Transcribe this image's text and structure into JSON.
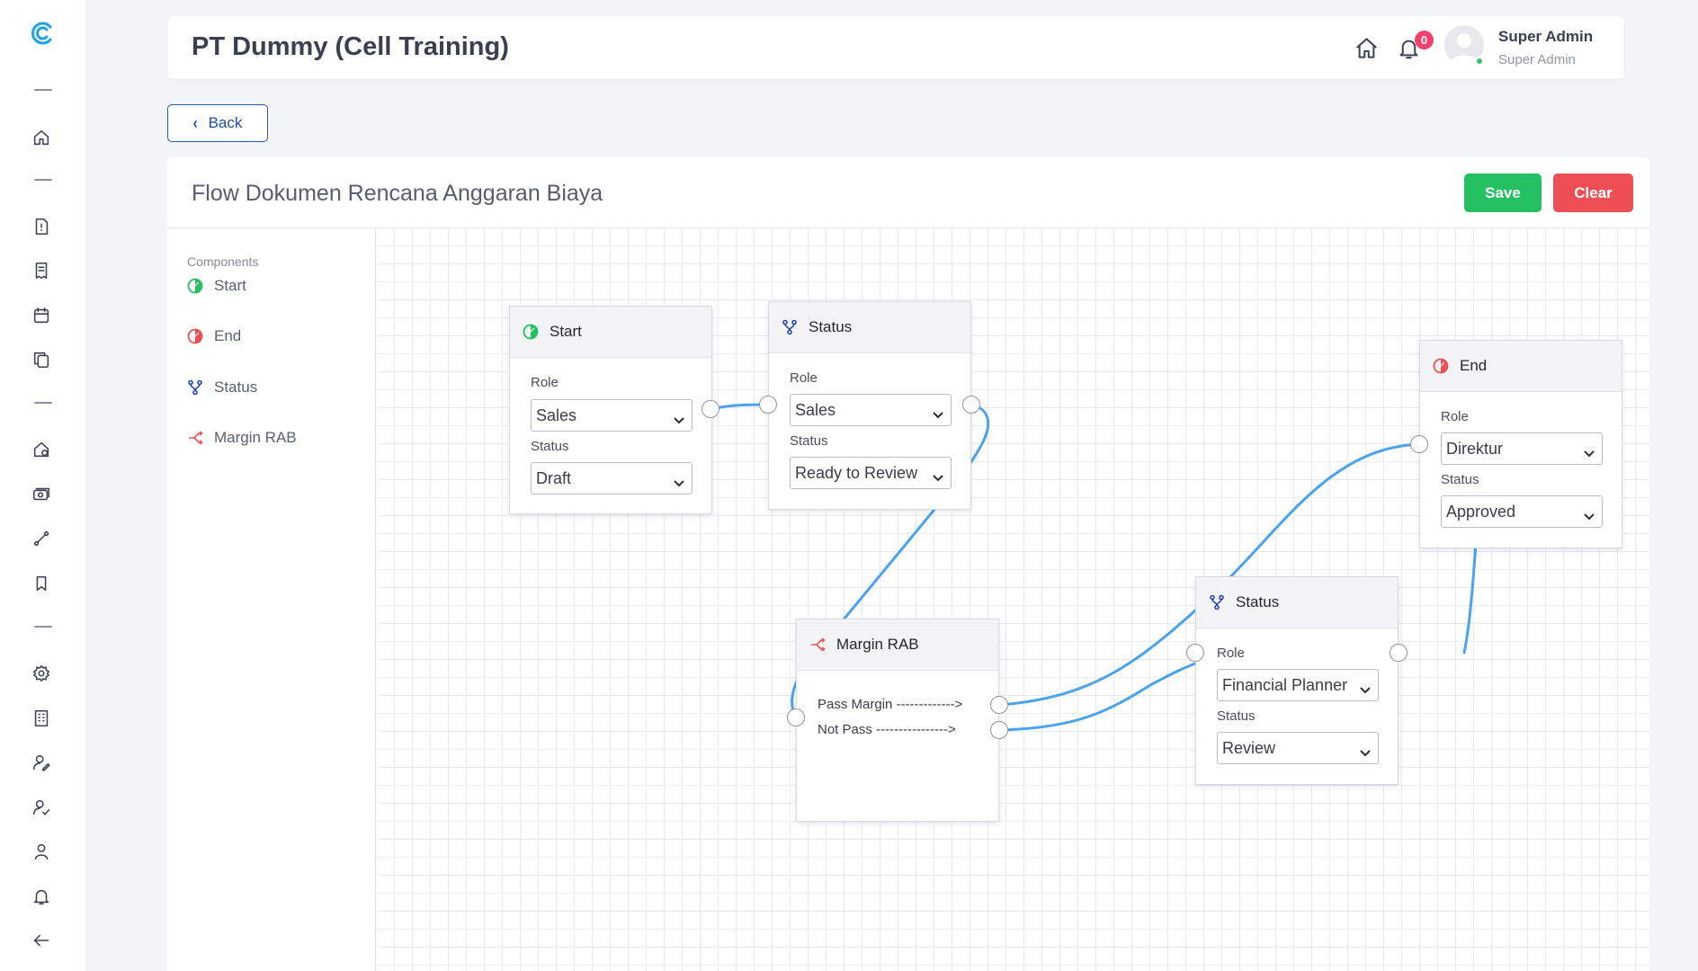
{
  "app": {
    "title": "PT Dummy (Cell Training)"
  },
  "header": {
    "notification_count": "0",
    "user": {
      "name": "Super Admin",
      "role": "Super Admin"
    }
  },
  "actions": {
    "back_label": "Back",
    "save_label": "Save",
    "clear_label": "Clear"
  },
  "page": {
    "title": "Flow Dokumen Rencana Anggaran Biaya"
  },
  "components": {
    "heading": "Components",
    "items": [
      {
        "label": "Start",
        "icon": "start-icon"
      },
      {
        "label": "End",
        "icon": "end-icon"
      },
      {
        "label": "Status",
        "icon": "status-icon"
      },
      {
        "label": "Margin RAB",
        "icon": "margin-rab-icon"
      }
    ]
  },
  "nodes": {
    "start": {
      "title": "Start",
      "role_label": "Role",
      "role": "Sales",
      "status_label": "Status",
      "status": "Draft"
    },
    "status1": {
      "title": "Status",
      "role_label": "Role",
      "role": "Sales",
      "status_label": "Status",
      "status": "Ready to Review"
    },
    "margin": {
      "title": "Margin RAB",
      "out1": "Pass Margin ------------->",
      "out2": "Not Pass ---------------->"
    },
    "status2": {
      "title": "Status",
      "role_label": "Role",
      "role": "Financial Planner",
      "status_label": "Status",
      "status": "Review"
    },
    "end": {
      "title": "End",
      "role_label": "Role",
      "role": "Direktur",
      "status_label": "Status",
      "status": "Approved"
    }
  },
  "colors": {
    "accent": "#1e4bb0",
    "save": "#25c062",
    "clear": "#ed4f55",
    "wire": "#4aa3ec",
    "start": "#25c062",
    "end": "#ed4f55",
    "status": "#2346b8"
  }
}
